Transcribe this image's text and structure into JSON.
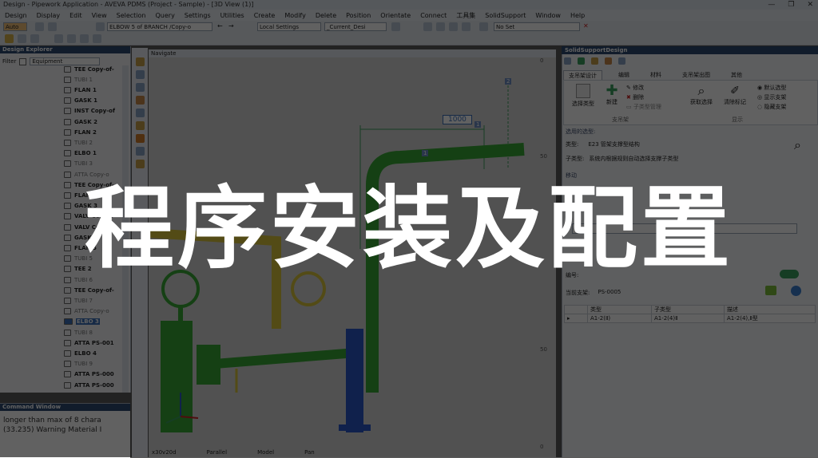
{
  "window": {
    "title": "Design - Pipework Application - AVEVA PDMS (Project - Sample) - [3D View (1)]",
    "controls": [
      "—",
      "❐",
      "✕"
    ]
  },
  "menu": [
    "Design",
    "Display",
    "Edit",
    "View",
    "Selection",
    "Query",
    "Settings",
    "Utilities",
    "Create",
    "Modify",
    "Delete",
    "Position",
    "Orientate",
    "Connect",
    "工具集",
    "SolidSupport",
    "Window",
    "Help"
  ],
  "toolbar": {
    "auto_label": "Auto",
    "element_field": "ELBOW 5 of BRANCH /Copy-o",
    "settings_field": "Local Settings",
    "current_field": "_Current_Desi",
    "noset_field": "No Set"
  },
  "explorer": {
    "title": "Design Explorer",
    "filter_label": "Filter",
    "filter_value": "Equipment",
    "items": [
      {
        "label": "TEE Copy-of-",
        "bold": true
      },
      {
        "label": "TUBI 1",
        "bold": false
      },
      {
        "label": "FLAN 1",
        "bold": true
      },
      {
        "label": "GASK 1",
        "bold": true
      },
      {
        "label": "INST Copy-of",
        "bold": true
      },
      {
        "label": "GASK 2",
        "bold": true
      },
      {
        "label": "FLAN 2",
        "bold": true
      },
      {
        "label": "TUBI 2",
        "bold": false
      },
      {
        "label": "ELBO 1",
        "bold": true
      },
      {
        "label": "TUBI 3",
        "bold": false
      },
      {
        "label": "ATTA Copy-o",
        "bold": false
      },
      {
        "label": "TEE Copy-of-",
        "bold": true
      },
      {
        "label": "FLAN 3",
        "bold": true
      },
      {
        "label": "GASK 3",
        "bold": true
      },
      {
        "label": "VALV Copy-o",
        "bold": true
      },
      {
        "label": "VALV Copy-o",
        "bold": true
      },
      {
        "label": "GASK 8",
        "bold": true
      },
      {
        "label": "FLAN 5",
        "bold": true
      },
      {
        "label": "TUBI 5",
        "bold": false
      },
      {
        "label": "TEE 2",
        "bold": true
      },
      {
        "label": "TUBI 6",
        "bold": false
      },
      {
        "label": "TEE Copy-of-",
        "bold": true
      },
      {
        "label": "TUBI 7",
        "bold": false
      },
      {
        "label": "ATTA Copy-o",
        "bold": false
      },
      {
        "label": "ELBO 3",
        "bold": true,
        "selected": true
      },
      {
        "label": "TUBI 8",
        "bold": false
      },
      {
        "label": "ATTA PS-001",
        "bold": true
      },
      {
        "label": "ELBO 4",
        "bold": true
      },
      {
        "label": "TUBI 9",
        "bold": false
      },
      {
        "label": "ATTA PS-000",
        "bold": true
      },
      {
        "label": "ATTA PS-000",
        "bold": true
      }
    ]
  },
  "command_window": {
    "title": "Command Window",
    "lines": [
      "longer than max of 8 chara",
      "(33.235) Warning Material I"
    ]
  },
  "view": {
    "tab_label": "Navigate",
    "dimension": "1000",
    "status": [
      "x30v20d",
      "Parallel",
      "Model",
      "Pan"
    ],
    "ruler": [
      "0",
      "50",
      "50",
      "0"
    ],
    "tags": [
      "2",
      "1",
      "1"
    ]
  },
  "solid_support": {
    "title": "SolidSupportDesign",
    "tabs": [
      "支吊架设计",
      "编辑",
      "材料",
      "支吊架出图",
      "其他"
    ],
    "ribbon": {
      "select_type": "选择类型",
      "new": "新建",
      "modify": "修改",
      "delete": "删除",
      "child_part": "子类型管理",
      "get_select": "获取选择",
      "clear_mark": "清除标记",
      "default_select": "默认选型",
      "show_support": "显示支架",
      "hide_support": "隐藏支架",
      "group_left": "支吊架",
      "group_right": "显示"
    },
    "section_type": {
      "header": "选用的选型:",
      "type_label": "类型:",
      "type_value": "E23  管架支撑型结构",
      "subtype_label": "子类型:",
      "subtype_value": "系统内根据规则自动选择支撑子类型"
    },
    "section_move_header": "移动",
    "position_label": "编号:",
    "current_branch_label": "当前支架:",
    "current_branch_value": "PS-0005",
    "table": {
      "headers": [
        "类型",
        "子类型",
        "描述"
      ],
      "rows": [
        [
          "A1-2(Ⅱ)",
          "A1-2(4)Ⅱ",
          "A1-2(4),Ⅱ型"
        ]
      ]
    }
  },
  "overlay_title": "程序安装及配置",
  "colors": {
    "pipe_green": "#37a835",
    "pipe_yellow": "#d9c53a",
    "pipe_blue": "#2a57c9",
    "title_bar": "#2e4b72"
  }
}
